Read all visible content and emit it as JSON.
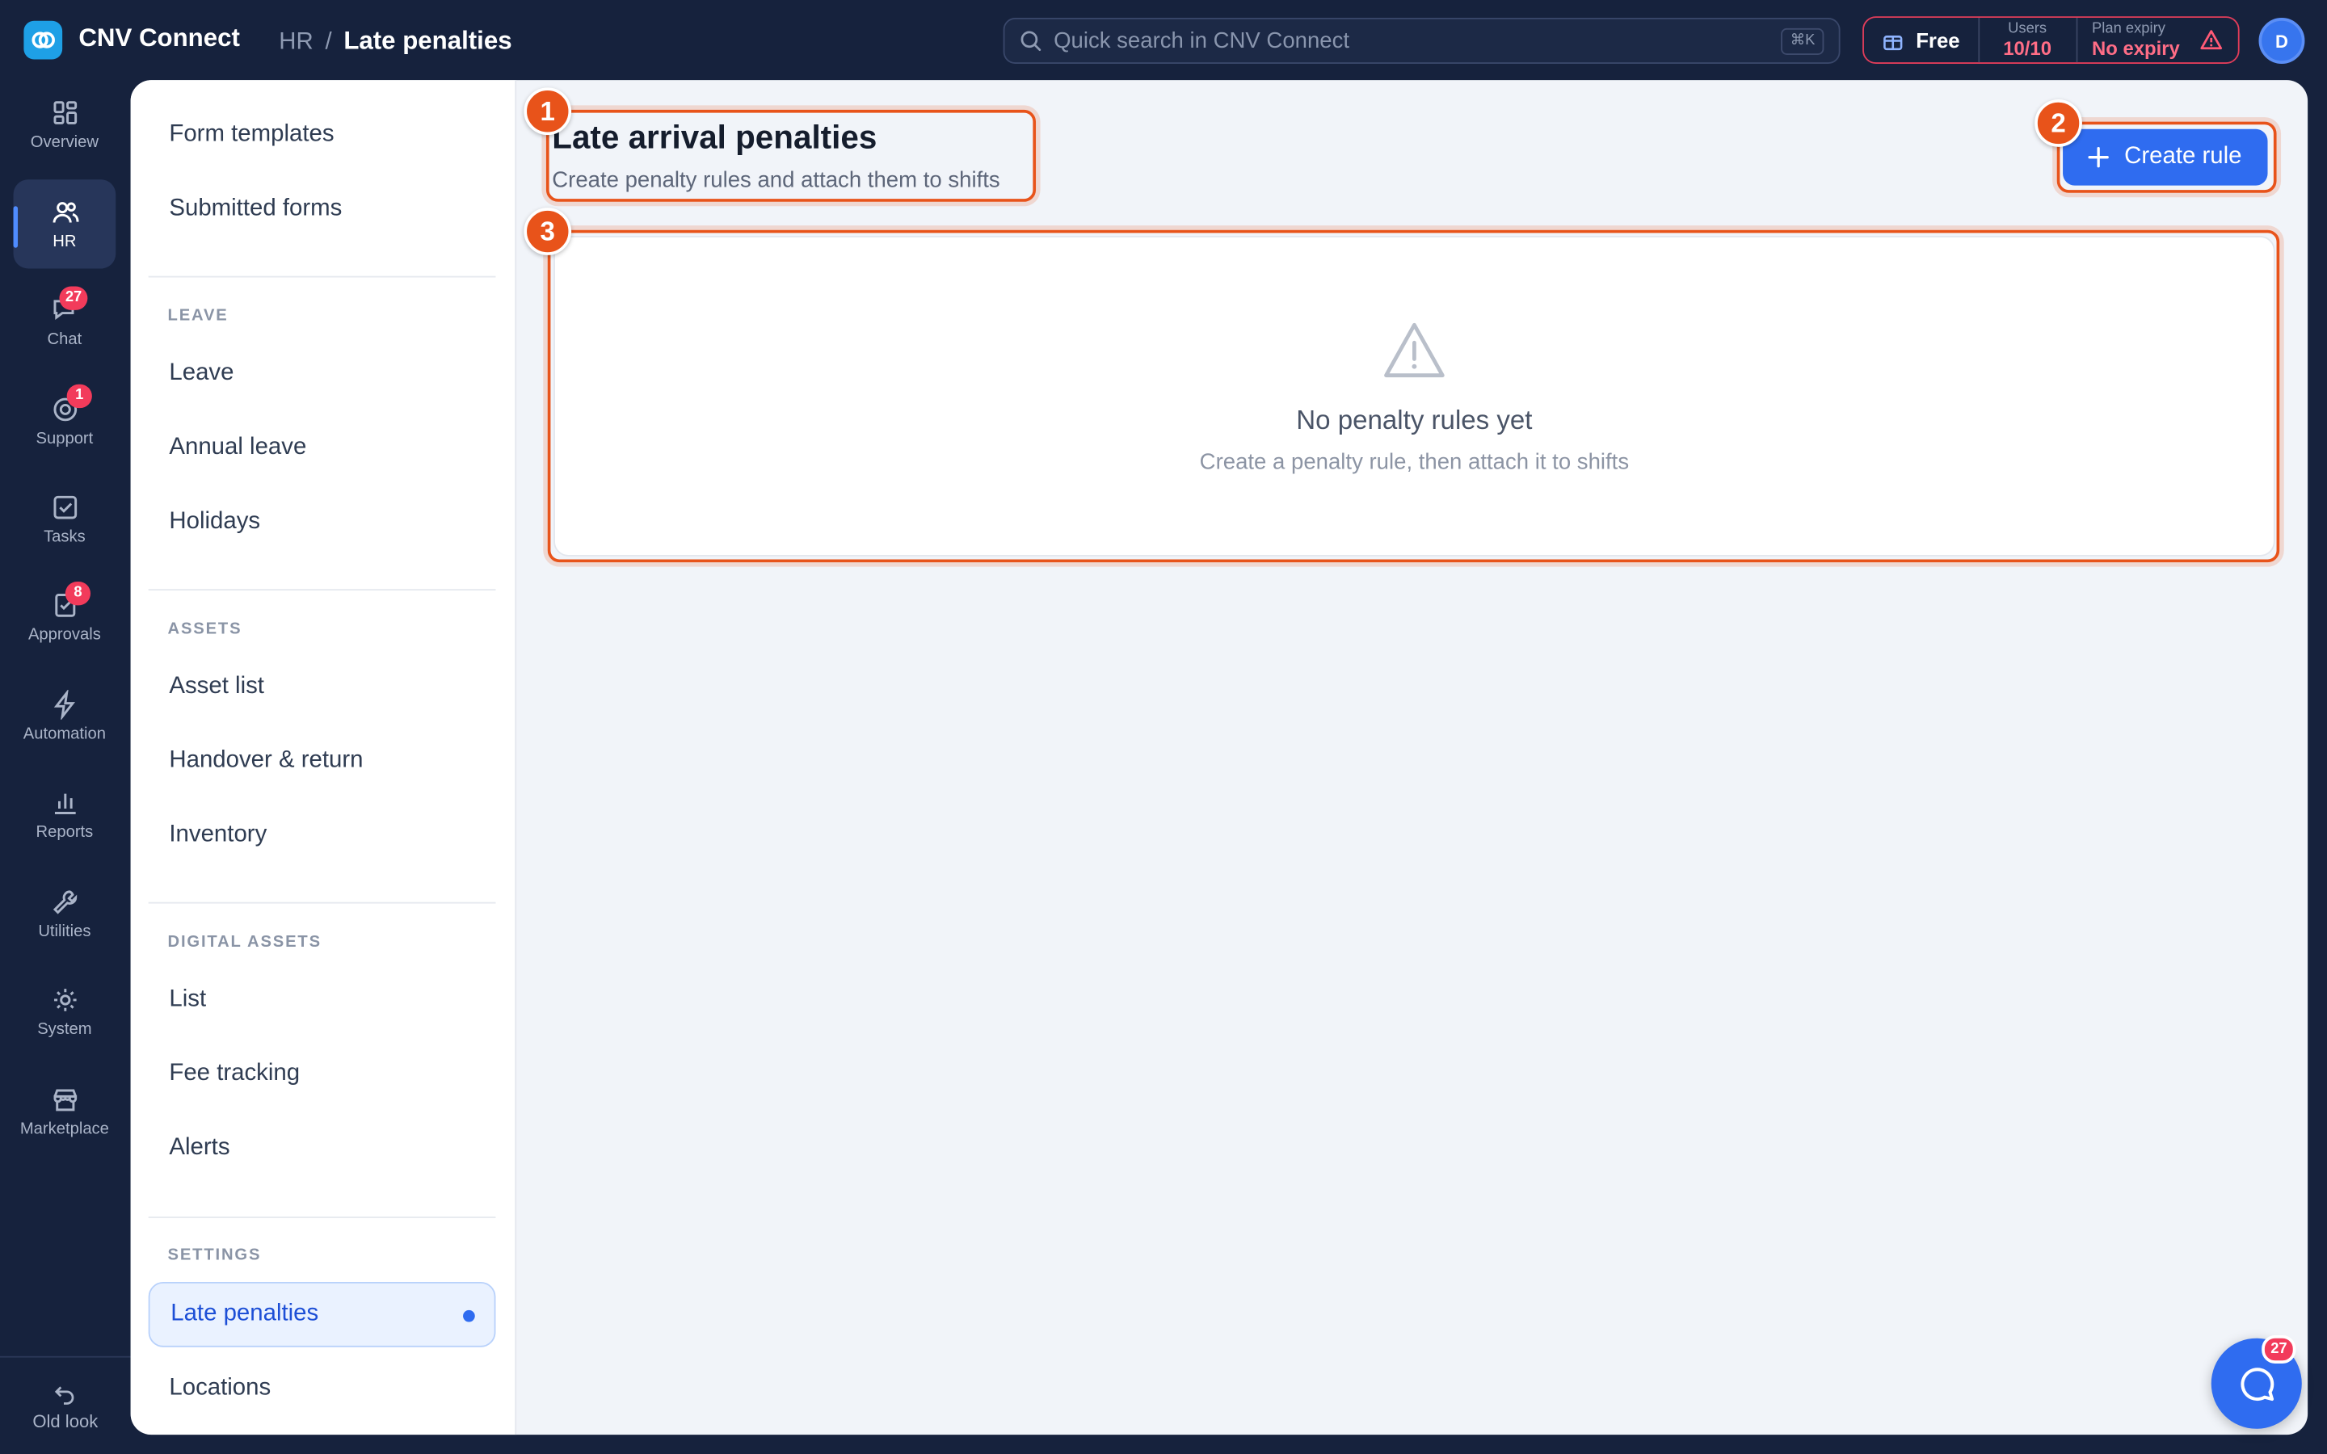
{
  "app": {
    "brand": "CNV Connect",
    "breadcrumb_root": "HR",
    "breadcrumb_sep": "/",
    "breadcrumb_current": "Late penalties"
  },
  "search": {
    "placeholder": "Quick search in CNV Connect",
    "shortcut": "⌘K"
  },
  "plan": {
    "name": "Free",
    "users_label": "Users",
    "users_value": "10/10",
    "expiry_label": "Plan expiry",
    "expiry_value": "No expiry"
  },
  "user": {
    "initial": "D"
  },
  "rail": {
    "items": [
      {
        "label": "Overview",
        "icon": "grid-icon"
      },
      {
        "label": "HR",
        "icon": "users-icon",
        "active": true
      },
      {
        "label": "Chat",
        "icon": "chat-icon",
        "badge": "27"
      },
      {
        "label": "Support",
        "icon": "support-icon",
        "badge": "1"
      },
      {
        "label": "Tasks",
        "icon": "checkbox-icon"
      },
      {
        "label": "Approvals",
        "icon": "approvals-icon",
        "badge": "8"
      },
      {
        "label": "Automation",
        "icon": "bolt-icon"
      },
      {
        "label": "Reports",
        "icon": "bar-chart-icon"
      },
      {
        "label": "Utilities",
        "icon": "wrench-icon"
      },
      {
        "label": "System",
        "icon": "gear-icon"
      },
      {
        "label": "Marketplace",
        "icon": "store-icon"
      }
    ],
    "footer": "Old look"
  },
  "sidebar": {
    "top_items": [
      "Form templates",
      "Submitted forms"
    ],
    "sections": [
      {
        "heading": "LEAVE",
        "items": [
          "Leave",
          "Annual leave",
          "Holidays"
        ]
      },
      {
        "heading": "ASSETS",
        "items": [
          "Asset list",
          "Handover & return",
          "Inventory"
        ]
      },
      {
        "heading": "DIGITAL ASSETS",
        "items": [
          "List",
          "Fee tracking",
          "Alerts"
        ]
      },
      {
        "heading": "SETTINGS",
        "items": [
          "Late penalties",
          "Locations"
        ]
      }
    ],
    "active_item": "Late penalties"
  },
  "page": {
    "title": "Late arrival penalties",
    "subtitle": "Create penalty rules and attach them to shifts",
    "create_button": "Create rule",
    "empty_title": "No penalty rules yet",
    "empty_subtitle": "Create a penalty rule, then attach it to shifts"
  },
  "annotations": [
    "1",
    "2",
    "3"
  ],
  "chat_fab": {
    "badge": "27"
  },
  "colors": {
    "topbar_bg": "#16223d",
    "accent": "#2f6cf0",
    "highlight": "#e8531a",
    "alert": "#f23b5b"
  }
}
